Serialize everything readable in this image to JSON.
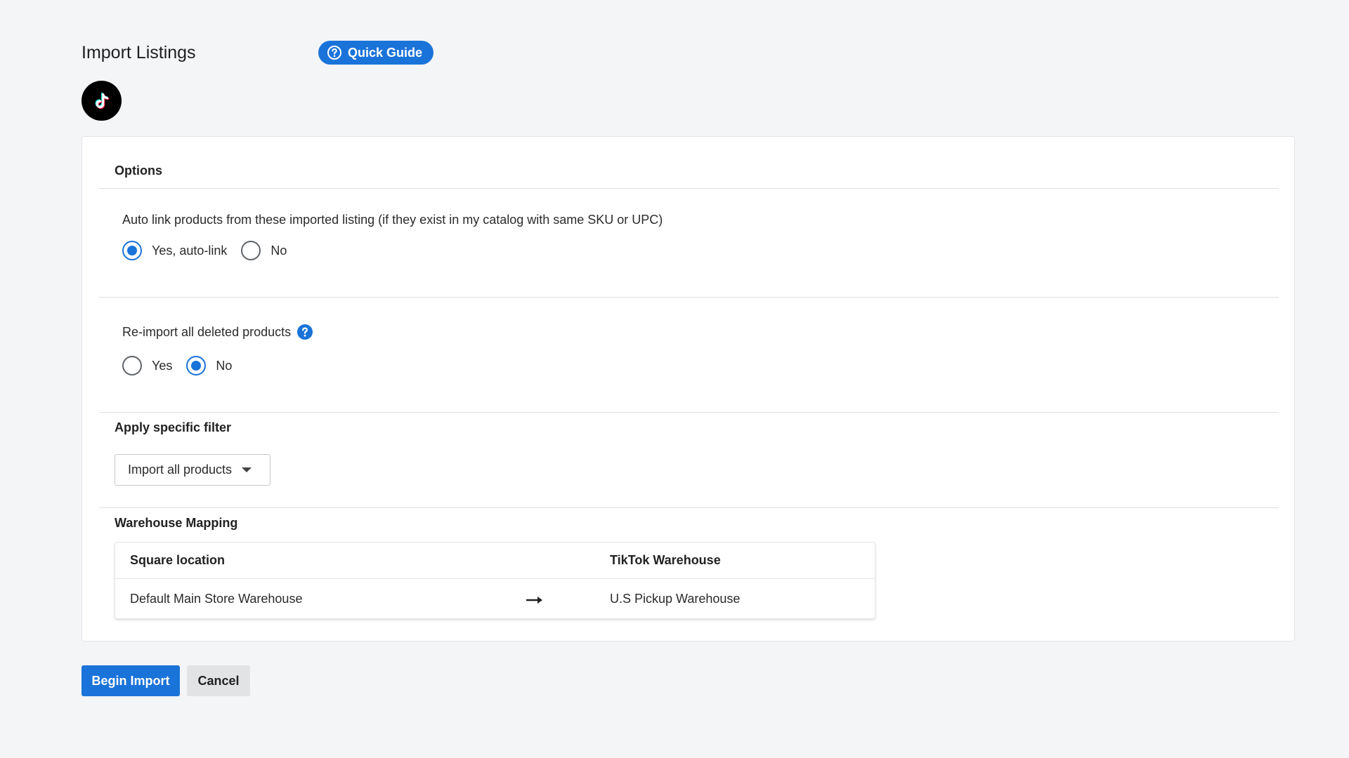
{
  "header": {
    "title": "Import Listings",
    "quick_guide_label": "Quick Guide",
    "quick_guide_icon": "question-circle-icon",
    "logo_icon": "tiktok-logo-icon"
  },
  "options": {
    "title": "Options",
    "auto_link": {
      "question": "Auto link products from these imported listing (if they exist in my catalog with same SKU or UPC)",
      "choices": [
        {
          "label": "Yes, auto-link",
          "selected": true
        },
        {
          "label": "No",
          "selected": false
        }
      ]
    },
    "reimport": {
      "question": "Re-import all deleted products",
      "help_icon": "help-icon",
      "choices": [
        {
          "label": "Yes",
          "selected": false
        },
        {
          "label": "No",
          "selected": true
        }
      ]
    }
  },
  "filter": {
    "title": "Apply specific filter",
    "selected": "Import all products"
  },
  "warehouse": {
    "title": "Warehouse Mapping",
    "columns": [
      "Square location",
      "TikTok Warehouse"
    ],
    "rows": [
      {
        "source": "Default Main Store Warehouse",
        "arrow_icon": "arrow-right-icon",
        "target": "U.S Pickup Warehouse"
      }
    ]
  },
  "actions": {
    "primary": "Begin Import",
    "secondary": "Cancel"
  },
  "colors": {
    "accent": "#1a73d9",
    "background": "#f4f5f7"
  }
}
